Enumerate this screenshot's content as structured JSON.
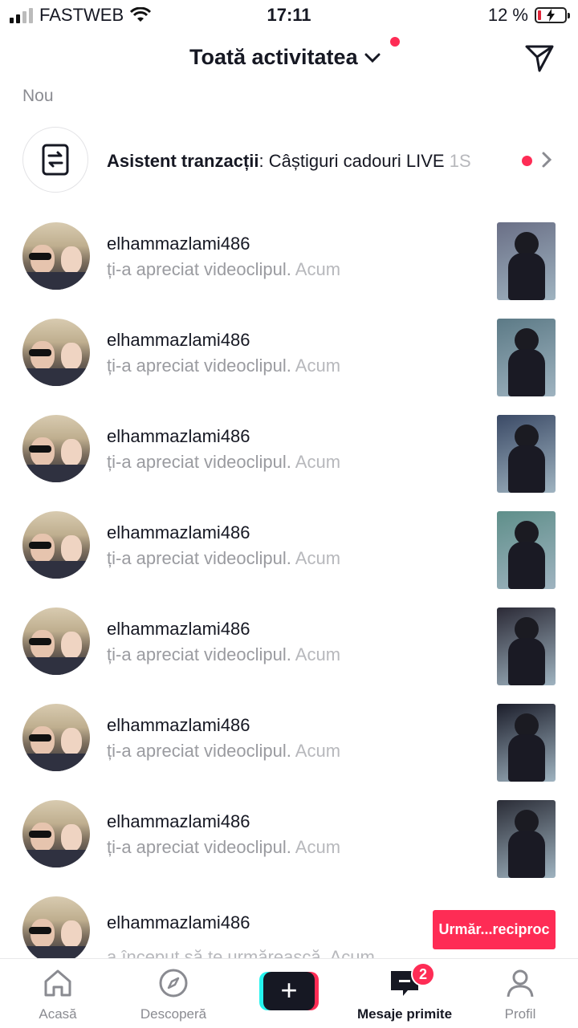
{
  "status_bar": {
    "carrier": "FASTWEB",
    "time": "17:11",
    "battery_percent": "12 %"
  },
  "header": {
    "title": "Toată activitatea"
  },
  "section_label": "Nou",
  "assistant": {
    "name": "Asistent tranzacții",
    "message": ": Câștiguri cadouri LIVE ",
    "time": "1S"
  },
  "rows": [
    {
      "username": "elhammazlami486",
      "action": "ți-a apreciat videoclipul. ",
      "time": "Acum"
    },
    {
      "username": "elhammazlami486",
      "action": "ți-a apreciat videoclipul. ",
      "time": "Acum"
    },
    {
      "username": "elhammazlami486",
      "action": "ți-a apreciat videoclipul. ",
      "time": "Acum"
    },
    {
      "username": "elhammazlami486",
      "action": "ți-a apreciat videoclipul. ",
      "time": "Acum"
    },
    {
      "username": "elhammazlami486",
      "action": "ți-a apreciat videoclipul. ",
      "time": "Acum"
    },
    {
      "username": "elhammazlami486",
      "action": "ți-a apreciat videoclipul. ",
      "time": "Acum"
    },
    {
      "username": "elhammazlami486",
      "action": "ți-a apreciat videoclipul. ",
      "time": "Acum"
    }
  ],
  "last_row": {
    "username": "elhammazlami486",
    "action": "a început să te urmărească. Acum",
    "follow_button": "Urmăr...reciproc"
  },
  "thumb_colors": [
    "#6a6f86",
    "#5c7a86",
    "#3b4a66",
    "#5f8f8a",
    "#2b2a36",
    "#1b1d2a",
    "#2a2c36"
  ],
  "tabbar": {
    "home": "Acasă",
    "discover": "Descoperă",
    "inbox": "Mesaje primite",
    "inbox_badge": "2",
    "profile": "Profil"
  },
  "colors": {
    "accent": "#fe2c55",
    "text": "#161823",
    "muted": "#9a9ba0"
  }
}
